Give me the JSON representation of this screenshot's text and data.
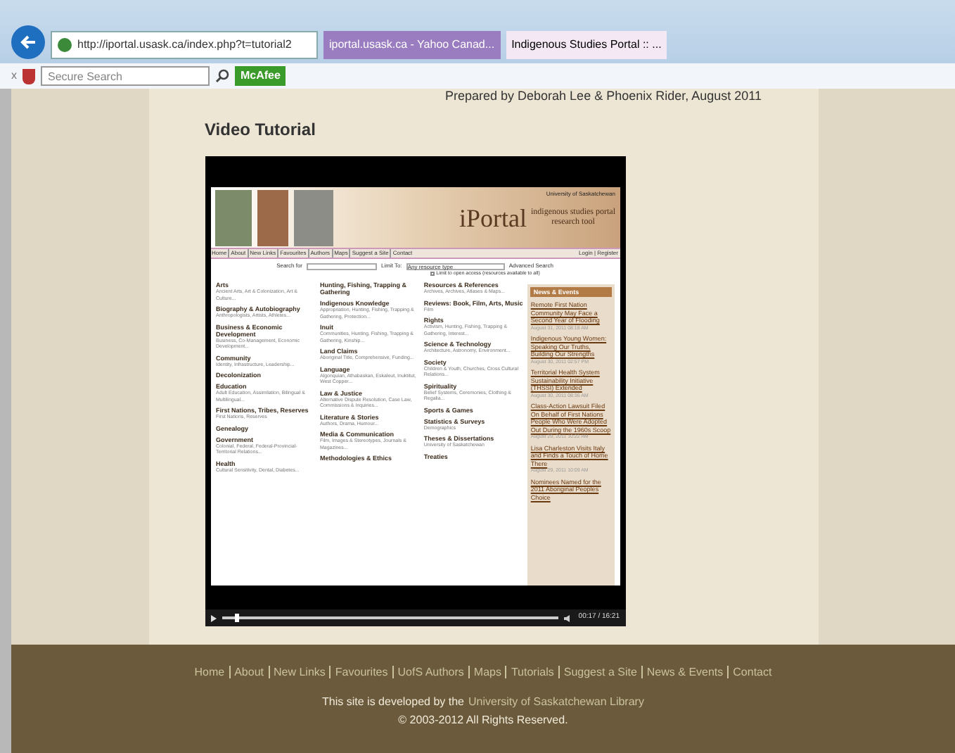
{
  "browser": {
    "url": "http://iportal.usask.ca/index.php?t=tutorial2",
    "tabs": [
      {
        "label": "iportal.usask.ca - Yahoo Canad...",
        "selected": false
      },
      {
        "label": "Indigenous Studies Portal :: ...",
        "selected": true
      }
    ],
    "toolbar": {
      "close": "x",
      "search_placeholder": "Secure Search",
      "mcafee": "McAfee"
    }
  },
  "page": {
    "credit": "Prepared by Deborah Lee & Phoenix Rider, August 2011",
    "heading": "Video Tutorial"
  },
  "video": {
    "site": {
      "title": "iPortal",
      "subtitle": "indigenous studies portal",
      "subtitle2": "research tool",
      "university": "University of Saskatchewan",
      "nav": [
        "Home",
        "About",
        "New Links",
        "Favourites",
        "Authors",
        "Maps",
        "Suggest a Site",
        "Contact"
      ],
      "login": "Login | Register",
      "search_label": "Search for",
      "limit_label": "Limit To:",
      "limit_value": "Any resource type",
      "advanced": "Advanced Search",
      "open_access": {
        "label": "Limit to open access (resources available to all)",
        "checked": false
      },
      "columns": [
        [
          {
            "title": "Arts",
            "sub": "Ancient Arts, Art & Colonization, Art & Culture..."
          },
          {
            "title": "Biography & Autobiography",
            "sub": "Anthropologists, Artists, Athletes..."
          },
          {
            "title": "Business & Economic Development",
            "sub": "Business, Co-Management, Economic Development..."
          },
          {
            "title": "Community",
            "sub": "Identity, Infrastructure, Leadership..."
          },
          {
            "title": "Decolonization"
          },
          {
            "title": "Education",
            "sub": "Adult Education, Assimilation, Bilingual & Multilingual..."
          },
          {
            "title": "First Nations, Tribes, Reserves",
            "sub": "First Nations, Reserves"
          },
          {
            "title": "Genealogy"
          },
          {
            "title": "Government",
            "sub": "Colonial, Federal, Federal-Provincial-Territorial Relations..."
          },
          {
            "title": "Health",
            "sub": "Cultural Sensitivity, Dental, Diabetes..."
          }
        ],
        [
          {
            "title": "Hunting, Fishing, Trapping & Gathering"
          },
          {
            "title": "Indigenous Knowledge",
            "sub": "Appropriation, Hunting, Fishing, Trapping & Gathering, Protection..."
          },
          {
            "title": "Inuit",
            "sub": "Communities, Hunting, Fishing, Trapping & Gathering, Kinship..."
          },
          {
            "title": "Land Claims",
            "sub": "Aboriginal Title, Comprehensive, Funding..."
          },
          {
            "title": "Language",
            "sub": "Algonquian, Athabaskan, Eskaleut, Inuktitut, West Copper..."
          },
          {
            "title": "Law & Justice",
            "sub": "Alternative Dispute Resolution, Case Law, Commissions & Inquiries..."
          },
          {
            "title": "Literature & Stories",
            "sub": "Authors, Drama, Humour..."
          },
          {
            "title": "Media & Communication",
            "sub": "Film, Images & Stereotypes, Journals & Magazines..."
          },
          {
            "title": "Methodologies & Ethics"
          }
        ],
        [
          {
            "title": "Resources & References",
            "sub": "Archives, Archives, Atlases & Maps..."
          },
          {
            "title": "Reviews: Book, Film, Arts, Music",
            "sub": "Film"
          },
          {
            "title": "Rights",
            "sub": "Activism, Hunting, Fishing, Trapping & Gathering, Interest..."
          },
          {
            "title": "Science & Technology",
            "sub": "Architecture, Astronomy, Environment..."
          },
          {
            "title": "Society",
            "sub": "Children & Youth, Churches, Cross Cultural Relations..."
          },
          {
            "title": "Spirituality",
            "sub": "Belief Systems, Ceremonies, Clothing & Regalia..."
          },
          {
            "title": "Sports & Games"
          },
          {
            "title": "Statistics & Surveys",
            "sub": "Demographics"
          },
          {
            "title": "Theses & Dissertations",
            "sub": "University of Saskatchewan"
          },
          {
            "title": "Treaties"
          }
        ]
      ],
      "news_title": "News & Events",
      "news": [
        {
          "title": "Remote First Nation Community May Face a Second Year of Flooding",
          "date": "August 31, 2011 08:18 AM"
        },
        {
          "title": "Indigenous Young Women: Speaking Our Truths, Building Our Strengths",
          "date": "August 30, 2011 02:57 PM"
        },
        {
          "title": "Territorial Health System Sustainability Initiative (THSSI) Extended",
          "date": "August 30, 2011 08:36 AM"
        },
        {
          "title": "Class-Action Lawsuit Filed On Behalf of First Nations People Who Were Adopted Out During the 1960s Scoop",
          "date": "August 29, 2011 10:22 AM"
        },
        {
          "title": "Lisa Charleston Visits Italy and Finds a Touch of Home There",
          "date": "August 29, 2011 10:09 AM"
        },
        {
          "title": "Nominees Named for the 2011 Aboriginal Peoples Choice"
        }
      ]
    },
    "player": {
      "level": 0.04,
      "time": "00:17 / 16:21"
    }
  },
  "footer": {
    "links": [
      "Home",
      "About",
      "New Links",
      "Favourites",
      "UofS Authors",
      "Maps",
      "Tutorials",
      "Suggest a Site",
      "News & Events",
      "Contact"
    ],
    "developed_prefix": "This site is developed by the",
    "developed_link": "University of Saskatchewan Library",
    "copyright": "© 2003-2012 All Rights Reserved."
  }
}
